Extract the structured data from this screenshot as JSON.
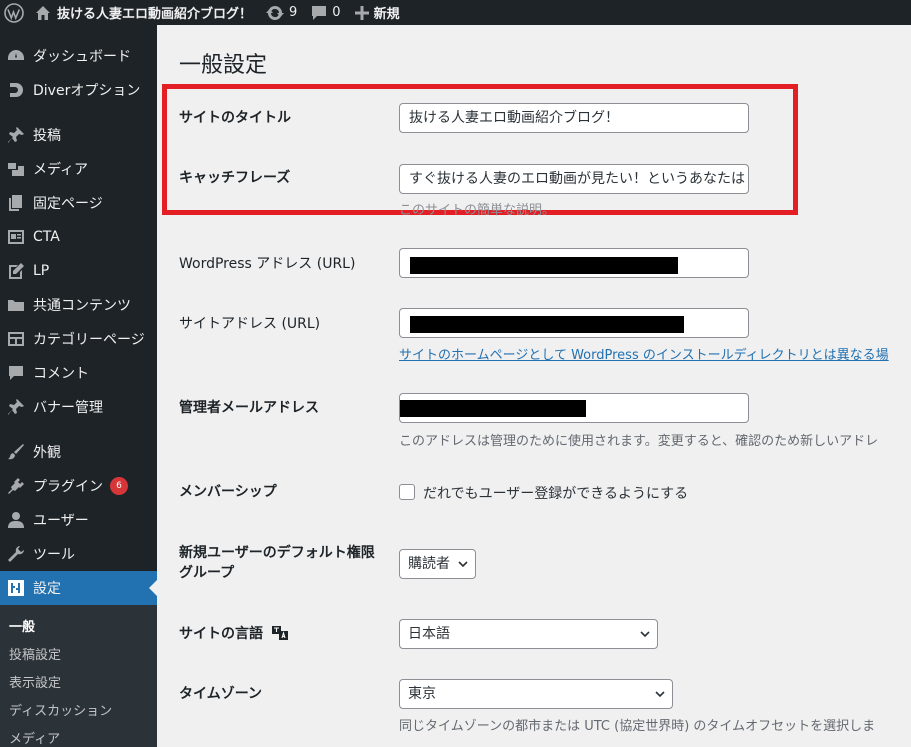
{
  "admin_bar": {
    "site_name": "抜ける人妻エロ動画紹介ブログ！",
    "updates_count": "9",
    "comments_count": "0",
    "new_label": "新規"
  },
  "sidebar": {
    "items": [
      {
        "label": "ダッシュボード",
        "icon": "dashboard-icon"
      },
      {
        "label": "Diverオプション",
        "icon": "diver-icon"
      },
      {
        "label": "投稿",
        "icon": "pin-icon"
      },
      {
        "label": "メディア",
        "icon": "media-icon"
      },
      {
        "label": "固定ページ",
        "icon": "page-icon"
      },
      {
        "label": "CTA",
        "icon": "cta-icon"
      },
      {
        "label": "LP",
        "icon": "edit-icon"
      },
      {
        "label": "共通コンテンツ",
        "icon": "folder-icon"
      },
      {
        "label": "カテゴリーページ",
        "icon": "layout-icon"
      },
      {
        "label": "コメント",
        "icon": "comment-icon"
      },
      {
        "label": "バナー管理",
        "icon": "pin-icon"
      },
      {
        "label": "外観",
        "icon": "brush-icon"
      },
      {
        "label": "プラグイン",
        "icon": "plugin-icon",
        "badge": "6"
      },
      {
        "label": "ユーザー",
        "icon": "user-icon"
      },
      {
        "label": "ツール",
        "icon": "wrench-icon"
      },
      {
        "label": "設定",
        "icon": "settings-icon"
      }
    ],
    "submenu": [
      "一般",
      "投稿設定",
      "表示設定",
      "ディスカッション",
      "メディア"
    ]
  },
  "page": {
    "title": "一般設定",
    "site_title_label": "サイトのタイトル",
    "site_title_value": "抜ける人妻エロ動画紹介ブログ！",
    "tagline_label": "キャッチフレーズ",
    "tagline_value": "すぐ抜ける人妻のエロ動画が見たい！というあなたは",
    "tagline_desc": "このサイトの簡単な説明。",
    "wp_address_label": "WordPress アドレス (URL)",
    "site_address_label": "サイトアドレス (URL)",
    "site_address_link": "サイトのホームページとして WordPress のインストールディレクトリとは異なる場",
    "admin_email_label": "管理者メールアドレス",
    "admin_email_desc": "このアドレスは管理のために使用されます。変更すると、確認のため新しいアドレ",
    "membership_label": "メンバーシップ",
    "membership_checkbox": "だれでもユーザー登録ができるようにする",
    "default_role_label_line1": "新規ユーザーのデフォルト権限",
    "default_role_label_line2": "グループ",
    "default_role_value": "購読者",
    "language_label": "サイトの言語",
    "language_value": "日本語",
    "timezone_label": "タイムゾーン",
    "timezone_value": "東京",
    "timezone_desc": "同じタイムゾーンの都市または UTC (協定世界時) のタイムオフセットを選択しま"
  },
  "colors": {
    "sidebar_bg": "#1d2327",
    "accent": "#2271b1",
    "highlight": "#e31e24",
    "badge": "#d63638"
  }
}
